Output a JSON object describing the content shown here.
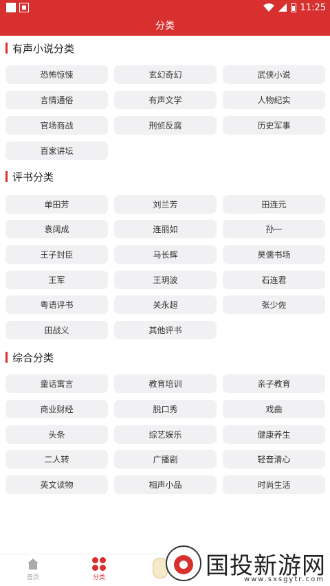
{
  "status_bar": {
    "time": "11:25"
  },
  "app_bar": {
    "title": "分类"
  },
  "sections": [
    {
      "title": "有声小说分类",
      "items": [
        "恐怖惊悚",
        "玄幻奇幻",
        "武侠小说",
        "言情通俗",
        "有声文学",
        "人物纪实",
        "官场商战",
        "刑侦反腐",
        "历史军事",
        "百家讲坛"
      ]
    },
    {
      "title": "评书分类",
      "items": [
        "单田芳",
        "刘兰芳",
        "田连元",
        "袁阔成",
        "连丽如",
        "孙一",
        "王子封臣",
        "马长辉",
        "昊儒书场",
        "王军",
        "王玥波",
        "石连君",
        "粤语评书",
        "关永超",
        "张少佐",
        "田战义",
        "其他评书"
      ]
    },
    {
      "title": "综合分类",
      "items": [
        "童话寓言",
        "教育培训",
        "亲子教育",
        "商业财经",
        "脱口秀",
        "戏曲",
        "头条",
        "综艺娱乐",
        "健康养生",
        "二人转",
        "广播剧",
        "轻音清心",
        "英文读物",
        "相声小品",
        "时尚生活"
      ]
    }
  ],
  "bottom_nav": [
    {
      "label": "首页",
      "icon": "home-icon"
    },
    {
      "label": "分类",
      "icon": "category-icon"
    }
  ],
  "watermark": {
    "title": "国投新游网",
    "url": "www.sxsgytr.com"
  },
  "colors": {
    "accent": "#d7302f",
    "chip_bg": "#f1f1f3"
  }
}
